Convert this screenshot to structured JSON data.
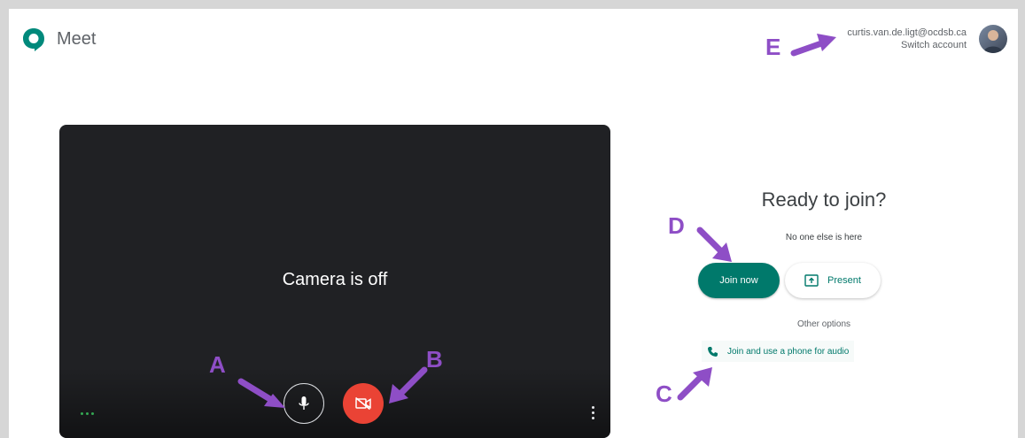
{
  "app": {
    "name": "Meet"
  },
  "account": {
    "email": "curtis.van.de.ligt@ocdsb.ca",
    "switch_label": "Switch account"
  },
  "preview": {
    "camera_status": "Camera is off"
  },
  "join_panel": {
    "heading": "Ready to join?",
    "status": "No one else is here",
    "join_label": "Join now",
    "present_label": "Present",
    "other_options_label": "Other options",
    "phone_label": "Join and use a phone for audio"
  },
  "annotations": {
    "a": "A",
    "b": "B",
    "c": "C",
    "d": "D",
    "e": "E"
  },
  "colors": {
    "annotation": "#8e4ec6",
    "join": "#00796b",
    "camera_off": "#ea4335",
    "preview_bg": "#202124"
  }
}
